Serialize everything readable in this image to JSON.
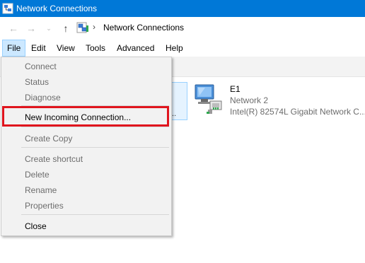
{
  "window": {
    "title": "Network Connections"
  },
  "nav": {
    "back_icon": "back-arrow-icon",
    "forward_icon": "forward-arrow-icon",
    "recent_icon": "chevron-down-icon",
    "up_icon": "up-arrow-icon",
    "address_icon": "network-folder-icon",
    "address_separator": "›",
    "address_text": "Network Connections"
  },
  "menubar": {
    "items": [
      "File",
      "Edit",
      "View",
      "Tools",
      "Advanced",
      "Help"
    ],
    "active": "File"
  },
  "file_menu": {
    "items": [
      {
        "label": "Connect",
        "enabled": false
      },
      {
        "label": "Status",
        "enabled": false
      },
      {
        "label": "Diagnose",
        "enabled": false
      },
      {
        "label": "New Incoming Connection...",
        "enabled": true,
        "highlighted": true
      },
      {
        "label": "Create Copy",
        "enabled": false
      },
      {
        "label": "Create shortcut",
        "enabled": false
      },
      {
        "label": "Delete",
        "enabled": false
      },
      {
        "label": "Rename",
        "enabled": false
      },
      {
        "label": "Properties",
        "enabled": false
      },
      {
        "label": "Close",
        "enabled": true
      }
    ],
    "highlight_color": "#e0151e"
  },
  "adapters": [
    {
      "name": "E1",
      "network": "Network  2",
      "device": "Intel(R) 82574L Gigabit Network C...",
      "icon": "ethernet-adapter-icon"
    }
  ],
  "partial_adapter": {
    "ellipsis": "..."
  },
  "colors": {
    "titlebar": "#0078d7",
    "menu_active_bg": "#cce8ff",
    "menu_bg": "#f2f2f2"
  }
}
